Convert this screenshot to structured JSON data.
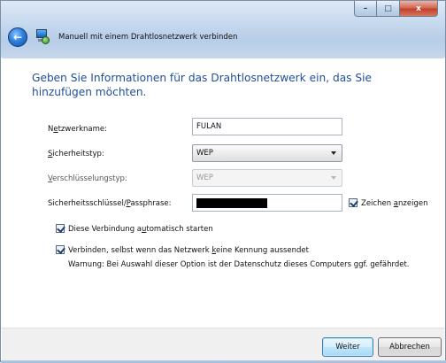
{
  "window": {
    "title": "Manuell mit einem Drahtlosnetzwerk verbinden",
    "controls": {
      "minimize": "–",
      "maximize": "□",
      "close": "x"
    },
    "back_glyph": "←"
  },
  "heading": "Geben Sie Informationen für das Drahtlosnetzwerk ein, das Sie hinzufügen möchten.",
  "form": {
    "network_name": {
      "label_pre": "N",
      "label_key": "e",
      "label_post": "tzwerkname:",
      "value": "FULAN"
    },
    "security_type": {
      "label_pre": "",
      "label_key": "S",
      "label_post": "icherheitstyp:",
      "value": "WEP"
    },
    "encryption_type": {
      "label_pre": "",
      "label_key": "V",
      "label_post": "erschlüsselungstyp:",
      "value": "WEP"
    },
    "security_key": {
      "label_pre": "Sicherheitsschlüssel/",
      "label_key": "P",
      "label_post": "assphrase:",
      "masked": true
    },
    "show_chars": {
      "label_pre": "Zeichen ",
      "label_key": "a",
      "label_post": "nzeigen",
      "checked": true
    }
  },
  "options": {
    "auto_start": {
      "label_pre": "Diese Verbindung a",
      "label_key": "u",
      "label_post": "tomatisch starten",
      "checked": true
    },
    "connect_hidden": {
      "label_pre": "Verbinden, selbst wenn das Netzwerk ",
      "label_key": "k",
      "label_post": "eine Kennung aussendet",
      "checked": true
    },
    "warning": "Warnung: Bei Auswahl dieser Option ist der Datenschutz dieses Computers ggf. gefährdet."
  },
  "buttons": {
    "next": "Weiter",
    "cancel": "Abbrechen"
  },
  "colors": {
    "heading": "#1f4f9a",
    "frame": "#b6cde8",
    "close_button": "#c1412a",
    "default_button": "#a7d9f5"
  }
}
